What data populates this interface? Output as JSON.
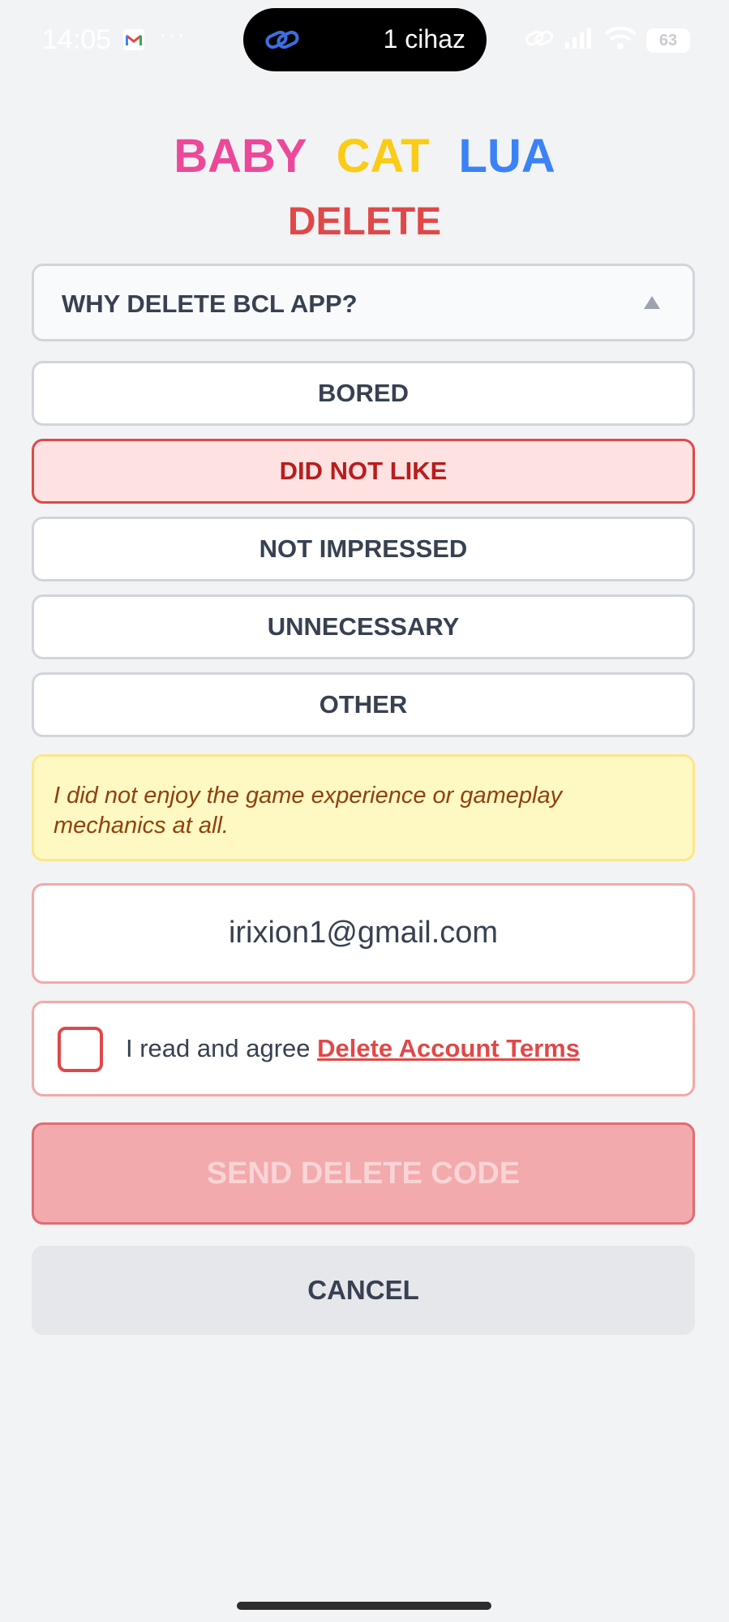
{
  "status_bar": {
    "time": "14:05",
    "dots": "···",
    "pill_text": "1 cihaz",
    "battery": "63"
  },
  "title": {
    "word1": "BABY",
    "word2": "CAT",
    "word3": "LUA",
    "subtitle": "DELETE"
  },
  "dropdown": {
    "label": "WHY DELETE BCL APP?"
  },
  "options": [
    {
      "label": "BORED",
      "selected": false
    },
    {
      "label": "DID NOT LIKE",
      "selected": true
    },
    {
      "label": "NOT IMPRESSED",
      "selected": false
    },
    {
      "label": "UNNECESSARY",
      "selected": false
    },
    {
      "label": "OTHER",
      "selected": false
    }
  ],
  "note": "I did not enjoy the game experience or gameplay mechanics at all.",
  "email": "irixion1@gmail.com",
  "agree": {
    "text": "I read and agree ",
    "link": "Delete Account Terms",
    "checked": false
  },
  "buttons": {
    "send": "SEND DELETE CODE",
    "cancel": "CANCEL"
  },
  "colors": {
    "baby": "#ec4899",
    "cat": "#facc15",
    "lua": "#3b82f6",
    "danger": "#e04848",
    "background": "#f2f3f5"
  },
  "icons": [
    "gmail-icon",
    "link-icon",
    "wifi-icon",
    "signal-icon",
    "battery-icon"
  ]
}
